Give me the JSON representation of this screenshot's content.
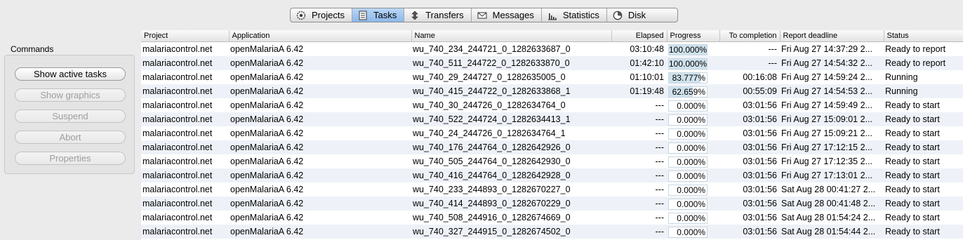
{
  "tabs": [
    {
      "label": "Projects",
      "icon": "projects-icon",
      "active": false
    },
    {
      "label": "Tasks",
      "icon": "tasks-icon",
      "active": true
    },
    {
      "label": "Transfers",
      "icon": "transfers-icon",
      "active": false
    },
    {
      "label": "Messages",
      "icon": "messages-icon",
      "active": false
    },
    {
      "label": "Statistics",
      "icon": "statistics-icon",
      "active": false
    },
    {
      "label": "Disk",
      "icon": "disk-icon",
      "active": false
    }
  ],
  "commands": {
    "title": "Commands",
    "buttons": [
      {
        "label": "Show active tasks",
        "enabled": true
      },
      {
        "label": "Show graphics",
        "enabled": false
      },
      {
        "label": "Suspend",
        "enabled": false
      },
      {
        "label": "Abort",
        "enabled": false
      },
      {
        "label": "Properties",
        "enabled": false
      }
    ]
  },
  "table": {
    "columns": [
      "Project",
      "Application",
      "Name",
      "Elapsed",
      "Progress",
      "To completion",
      "Report deadline",
      "Status"
    ],
    "rows": [
      {
        "project": "malariacontrol.net",
        "application": "openMalariaA 6.42",
        "name": "wu_740_234_244721_0_1282633687_0",
        "elapsed": "03:10:48",
        "progress": "100.000%",
        "progress_value": 1.0,
        "to_completion": "---",
        "deadline": "Fri Aug 27 14:37:29 2...",
        "status": "Ready to report"
      },
      {
        "project": "malariacontrol.net",
        "application": "openMalariaA 6.42",
        "name": "wu_740_511_244722_0_1282633870_0",
        "elapsed": "01:42:10",
        "progress": "100.000%",
        "progress_value": 1.0,
        "to_completion": "---",
        "deadline": "Fri Aug 27 14:54:32 2...",
        "status": "Ready to report"
      },
      {
        "project": "malariacontrol.net",
        "application": "openMalariaA 6.42",
        "name": "wu_740_29_244727_0_1282635005_0",
        "elapsed": "01:10:01",
        "progress": "83.777%",
        "progress_value": 0.83777,
        "to_completion": "00:16:08",
        "deadline": "Fri Aug 27 14:59:24 2...",
        "status": "Running"
      },
      {
        "project": "malariacontrol.net",
        "application": "openMalariaA 6.42",
        "name": "wu_740_415_244722_0_1282633868_1",
        "elapsed": "01:19:48",
        "progress": "62.659%",
        "progress_value": 0.62659,
        "to_completion": "00:55:09",
        "deadline": "Fri Aug 27 14:54:53 2...",
        "status": "Running"
      },
      {
        "project": "malariacontrol.net",
        "application": "openMalariaA 6.42",
        "name": "wu_740_30_244726_0_1282634764_0",
        "elapsed": "---",
        "progress": "0.000%",
        "progress_value": 0,
        "to_completion": "03:01:56",
        "deadline": "Fri Aug 27 14:59:49 2...",
        "status": "Ready to start"
      },
      {
        "project": "malariacontrol.net",
        "application": "openMalariaA 6.42",
        "name": "wu_740_522_244724_0_1282634413_1",
        "elapsed": "---",
        "progress": "0.000%",
        "progress_value": 0,
        "to_completion": "03:01:56",
        "deadline": "Fri Aug 27 15:09:01 2...",
        "status": "Ready to start"
      },
      {
        "project": "malariacontrol.net",
        "application": "openMalariaA 6.42",
        "name": "wu_740_24_244726_0_1282634764_1",
        "elapsed": "---",
        "progress": "0.000%",
        "progress_value": 0,
        "to_completion": "03:01:56",
        "deadline": "Fri Aug 27 15:09:21 2...",
        "status": "Ready to start"
      },
      {
        "project": "malariacontrol.net",
        "application": "openMalariaA 6.42",
        "name": "wu_740_176_244764_0_1282642926_0",
        "elapsed": "---",
        "progress": "0.000%",
        "progress_value": 0,
        "to_completion": "03:01:56",
        "deadline": "Fri Aug 27 17:12:15 2...",
        "status": "Ready to start"
      },
      {
        "project": "malariacontrol.net",
        "application": "openMalariaA 6.42",
        "name": "wu_740_505_244764_0_1282642930_0",
        "elapsed": "---",
        "progress": "0.000%",
        "progress_value": 0,
        "to_completion": "03:01:56",
        "deadline": "Fri Aug 27 17:12:35 2...",
        "status": "Ready to start"
      },
      {
        "project": "malariacontrol.net",
        "application": "openMalariaA 6.42",
        "name": "wu_740_416_244764_0_1282642928_0",
        "elapsed": "---",
        "progress": "0.000%",
        "progress_value": 0,
        "to_completion": "03:01:56",
        "deadline": "Fri Aug 27 17:13:01 2...",
        "status": "Ready to start"
      },
      {
        "project": "malariacontrol.net",
        "application": "openMalariaA 6.42",
        "name": "wu_740_233_244893_0_1282670227_0",
        "elapsed": "---",
        "progress": "0.000%",
        "progress_value": 0,
        "to_completion": "03:01:56",
        "deadline": "Sat Aug 28 00:41:27 2...",
        "status": "Ready to start"
      },
      {
        "project": "malariacontrol.net",
        "application": "openMalariaA 6.42",
        "name": "wu_740_414_244893_0_1282670229_0",
        "elapsed": "---",
        "progress": "0.000%",
        "progress_value": 0,
        "to_completion": "03:01:56",
        "deadline": "Sat Aug 28 00:41:48 2...",
        "status": "Ready to start"
      },
      {
        "project": "malariacontrol.net",
        "application": "openMalariaA 6.42",
        "name": "wu_740_508_244916_0_1282674669_0",
        "elapsed": "---",
        "progress": "0.000%",
        "progress_value": 0,
        "to_completion": "03:01:56",
        "deadline": "Sat Aug 28 01:54:24 2...",
        "status": "Ready to start"
      },
      {
        "project": "malariacontrol.net",
        "application": "openMalariaA 6.42",
        "name": "wu_740_327_244915_0_1282674502_0",
        "elapsed": "---",
        "progress": "0.000%",
        "progress_value": 0,
        "to_completion": "03:01:56",
        "deadline": "Sat Aug 28 01:54:44 2...",
        "status": "Ready to start"
      }
    ]
  }
}
